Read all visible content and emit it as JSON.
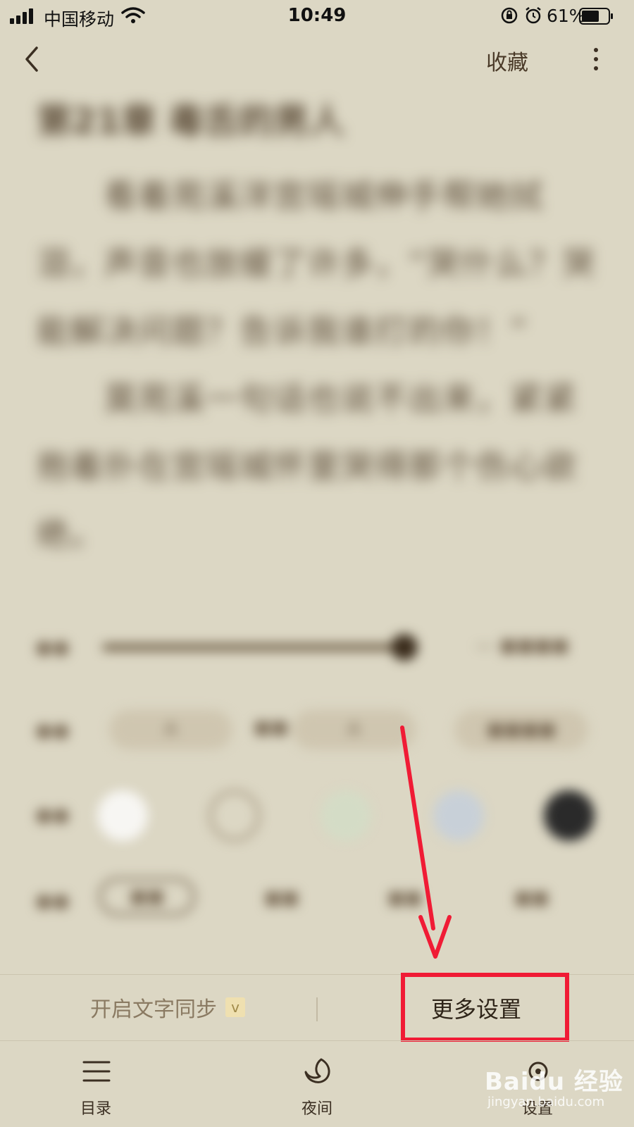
{
  "status_bar": {
    "carrier": "中国移动",
    "time": "10:49",
    "battery_percent": "61%"
  },
  "nav": {
    "favorite_label": "收藏"
  },
  "content": {
    "chapter_title": "第21章 毒舌的男人",
    "paragraphs": [
      "看着苑溪洋宫瑶城伸手帮她拭泪，声音也放缓了许多，“哭什么？哭能解决问题？告诉我谁打的你！”",
      "莫苑溪一句话也说不出来，紧紧抱着扑在宫瑶城怀里哭得那个伤心欲绝。"
    ]
  },
  "actions": {
    "sync_label": "开启文字同步",
    "sync_badge": "v",
    "more_settings_label": "更多设置"
  },
  "tabs": [
    {
      "label": "目录",
      "icon": "menu-icon"
    },
    {
      "label": "夜间",
      "icon": "moon-icon"
    },
    {
      "label": "设置",
      "icon": "settings-icon"
    }
  ],
  "colors": {
    "background": "#dcd7c4",
    "highlight": "#f01b35"
  },
  "watermark": {
    "logo": "Baidu 经验",
    "url": "jingyan.baidu.com"
  }
}
